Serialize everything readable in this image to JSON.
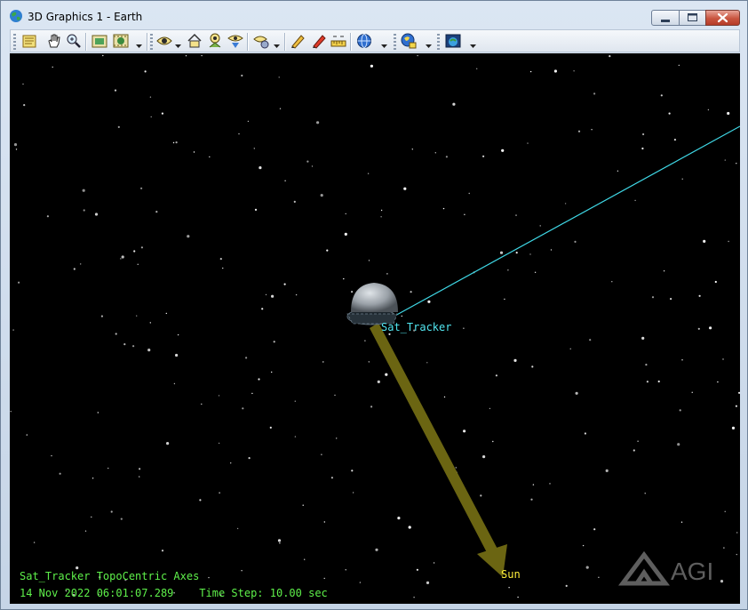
{
  "window": {
    "title": "3D Graphics 1 - Earth",
    "icon": "globe-icon",
    "controls": [
      "minimize-icon",
      "maximize-icon",
      "close-icon"
    ]
  },
  "toolbar": {
    "icons": [
      "properties-icon",
      "pan-hand-icon",
      "zoom-icon",
      "snapshot-icon",
      "record-movie-icon",
      "view-from-icon",
      "home-view-icon",
      "view-object-icon",
      "view-down-icon",
      "view-settings-icon",
      "pencil-icon",
      "marker-icon",
      "measure-icon",
      "globe-display-icon",
      "globe-lock-icon",
      "earth-view-icon"
    ]
  },
  "scene": {
    "satellite_label": "Sat_Tracker",
    "sun_label": "Sun",
    "status_axes": "Sat_Tracker TopoCentric Axes",
    "status_time": "14 Nov 2022 06:01:07.289    Time Step: 10.00 sec",
    "logo_text": "AGI",
    "colors": {
      "background": "#000000",
      "sun_vector": "#6b6512",
      "sat_line": "#3fd8e6",
      "sat_label": "#52e6f0",
      "sun_label": "#ffef3a",
      "status_text": "#5ef04a"
    }
  }
}
